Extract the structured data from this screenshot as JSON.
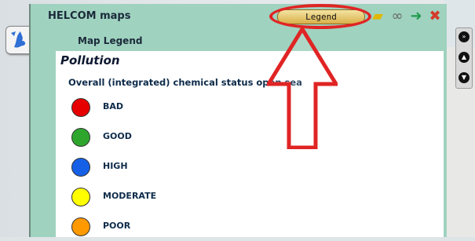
{
  "window": {
    "title": "HELCOM maps"
  },
  "toolbar": {
    "legend_label": "Legend"
  },
  "legend": {
    "header": "Map Legend",
    "section": "Pollution",
    "category": "Overall (integrated) chemical status open sea",
    "items": [
      {
        "label": "BAD",
        "color": "#e60000"
      },
      {
        "label": "GOOD",
        "color": "#2ea62e"
      },
      {
        "label": "HIGH",
        "color": "#1560e6"
      },
      {
        "label": "MODERATE",
        "color": "#ffff00"
      },
      {
        "label": "POOR",
        "color": "#ff9900"
      }
    ]
  },
  "icons": {
    "folder": "folder-icon",
    "link": "link-icon",
    "forward": "arrow-right-icon",
    "close": "close-icon"
  },
  "colors": {
    "annotation_red": "#e02424",
    "window_bg": "#9fd2bf"
  }
}
